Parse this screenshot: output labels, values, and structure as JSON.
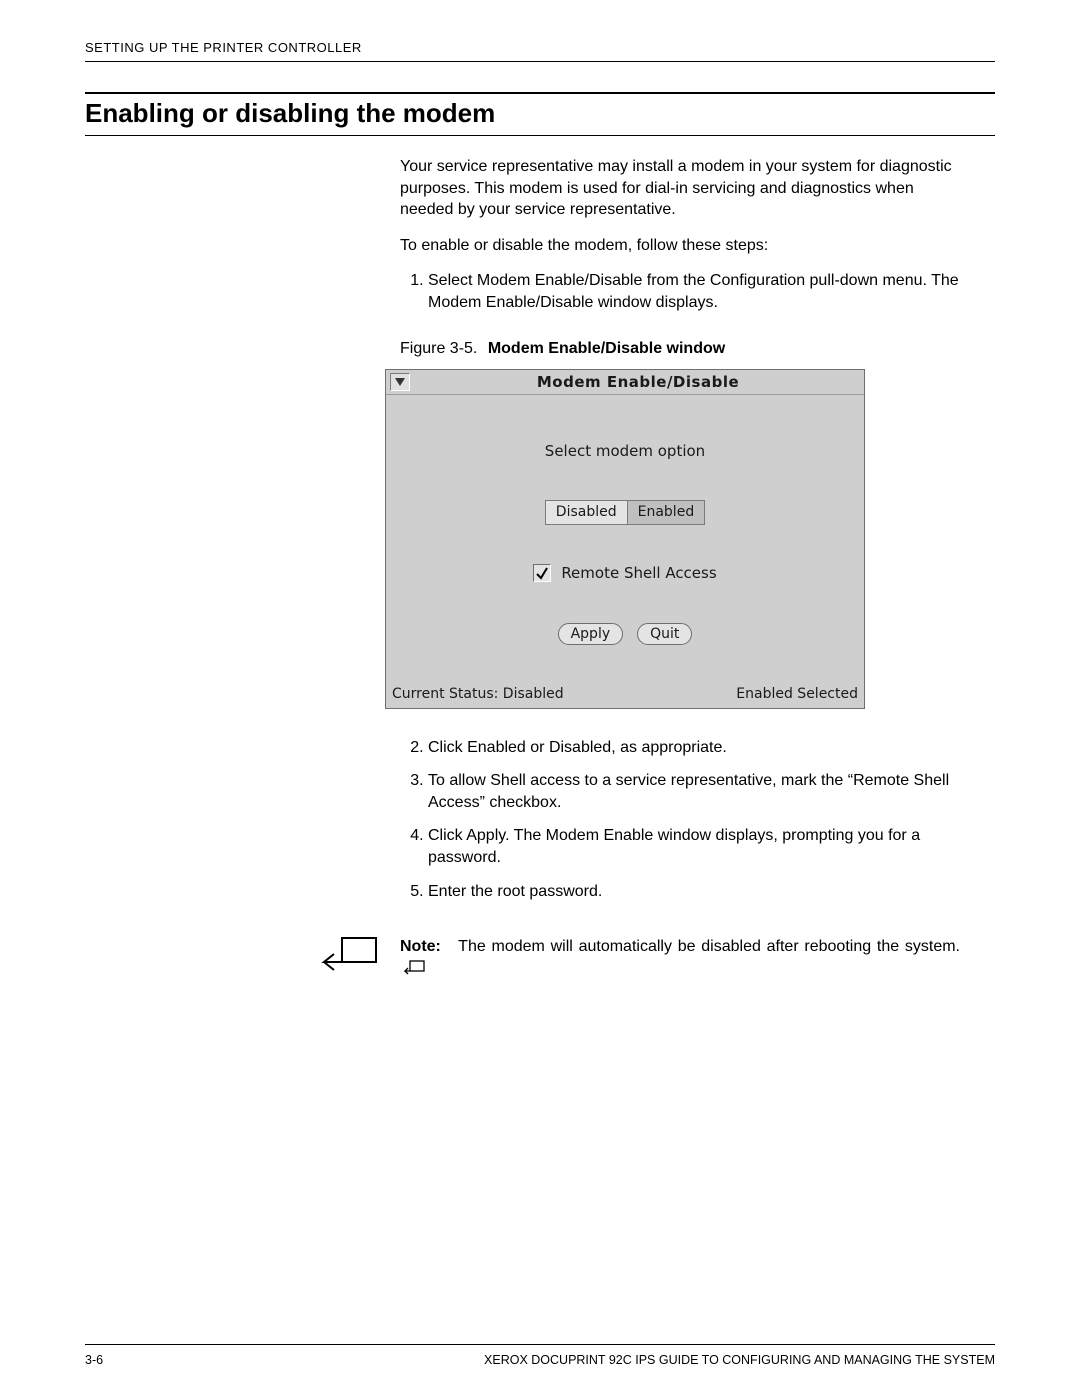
{
  "header": {
    "running_head": "SETTING UP THE PRINTER CONTROLLER"
  },
  "section": {
    "title": "Enabling or disabling the modem"
  },
  "body": {
    "intro1": "Your service representative may install a modem in your system for diagnostic purposes. This modem is used for dial-in servicing and diagnostics when needed by your service representative.",
    "intro2": "To enable or disable the modem, follow these steps:",
    "step1": "Select Modem Enable/Disable from the Configuration pull-down menu. The Modem Enable/Disable window displays.",
    "step2": "Click Enabled or Disabled, as appropriate.",
    "step3": "To allow Shell access to a service representative, mark the “Remote Shell Access” checkbox.",
    "step4": "Click Apply. The Modem Enable window displays, prompting you for a password.",
    "step5": "Enter the root password."
  },
  "figure": {
    "label": "Figure 3-5.",
    "title": "Modem Enable/Disable window",
    "dialog": {
      "title": "Modem Enable/Disable",
      "prompt": "Select modem option",
      "option_disabled": "Disabled",
      "option_enabled": "Enabled",
      "remote_shell_label": "Remote Shell Access",
      "apply": "Apply",
      "quit": "Quit",
      "status_left": "Current Status: Disabled",
      "status_right": "Enabled Selected"
    }
  },
  "note": {
    "lead": "Note:",
    "text": "The modem will automatically be disabled after rebooting the system."
  },
  "footer": {
    "page": "3-6",
    "book": "XEROX DOCUPRINT 92C IPS GUIDE TO CONFIGURING AND MANAGING THE SYSTEM"
  }
}
